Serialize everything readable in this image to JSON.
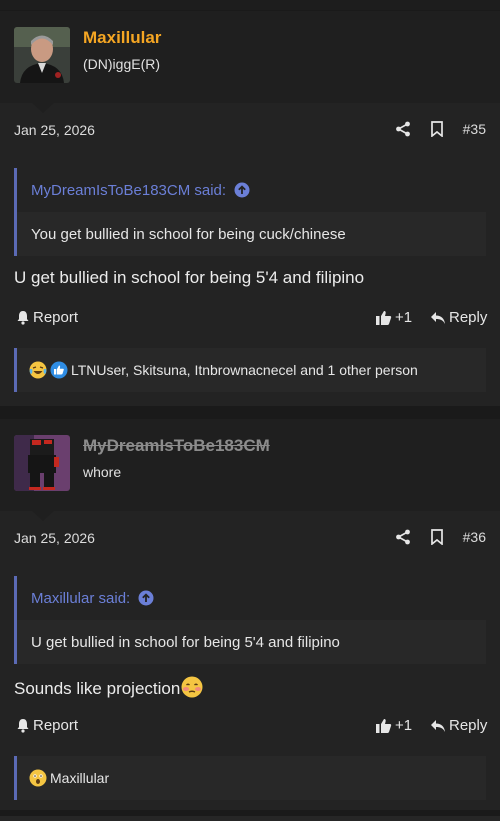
{
  "posts": [
    {
      "username": "Maxillular",
      "user_title": "(DN)iggE(R)",
      "username_color": "#f5a623",
      "date": "Jan 25, 2026",
      "post_number": "#35",
      "quote": {
        "author": "MyDreamIsToBe183CM said:",
        "text": "You get bullied in school for being cuck/chinese"
      },
      "message": "U get bullied in school for being 5'4 and filipino",
      "actions": {
        "report": "Report",
        "like": "+1",
        "reply": "Reply"
      },
      "reactions": {
        "icons": [
          "crying-laughing-emoji",
          "thumbs-up-icon"
        ],
        "text": "LTNUser, Skitsuna, Itnbrownacnecel and 1 other person"
      }
    },
    {
      "username": "MyDreamIsToBe183CM",
      "user_title": "whore",
      "username_color": "#8c8c8c",
      "date": "Jan 25, 2026",
      "post_number": "#36",
      "quote": {
        "author": "Maxillular said:",
        "text": "U get bullied in school for being 5'4 and filipino"
      },
      "message": "Sounds like projection",
      "message_emoji": "flushed-blushing-emoji",
      "actions": {
        "report": "Report",
        "like": "+1",
        "reply": "Reply"
      },
      "reactions": {
        "icons": [
          "surprised-emoji"
        ],
        "text": "Maxillular"
      }
    }
  ],
  "colors": {
    "accent_link": "#6b7fd7",
    "quote_border": "#5b6ab5",
    "username_highlight": "#f5a623"
  }
}
